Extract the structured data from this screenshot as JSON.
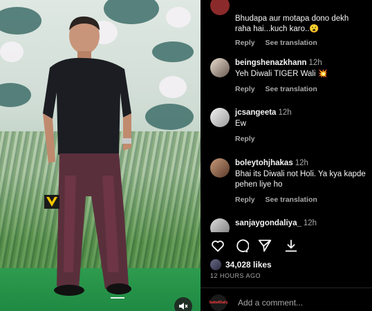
{
  "media": {
    "mute_icon": "speaker-muted-icon",
    "brand_mark": "v-logo-icon"
  },
  "comments": [
    {
      "username": "",
      "time": "",
      "text": "Bhudapa aur motapa dono dekh raha hai...kuch karo..😮",
      "reply": "Reply",
      "see_translation": "See translation"
    },
    {
      "username": "beingshenazkhann",
      "time": "12h",
      "text": "Yeh Diwali TIGER Wali 💥",
      "reply": "Reply",
      "see_translation": "See translation"
    },
    {
      "username": "jcsangeeta",
      "time": "12h",
      "text": "Ew",
      "reply": "Reply",
      "see_translation": ""
    },
    {
      "username": "boleytohjhakas",
      "time": "12h",
      "text": "Bhai its Diwali not Holi. Ya kya kapde pehen liye ho",
      "reply": "Reply",
      "see_translation": "See translation"
    },
    {
      "username": "sanjaygondaliya_",
      "time": "12h",
      "text": "",
      "reply": "",
      "see_translation": ""
    }
  ],
  "actions": {
    "like_icon": "heart-icon",
    "comment_icon": "comment-bubble-icon",
    "share_icon": "paper-plane-icon",
    "save_icon": "download-icon"
  },
  "likes": "34,028 likes",
  "post_time": "12 HOURS AGO",
  "add_comment": {
    "placeholder": "Add a comment...",
    "avatar_label": "Satta4Daily"
  },
  "colors": {
    "background": "#000000",
    "text_primary": "#f5f5f5",
    "text_secondary": "#a8a8a8",
    "carpet_green": "#2e9b4e"
  }
}
